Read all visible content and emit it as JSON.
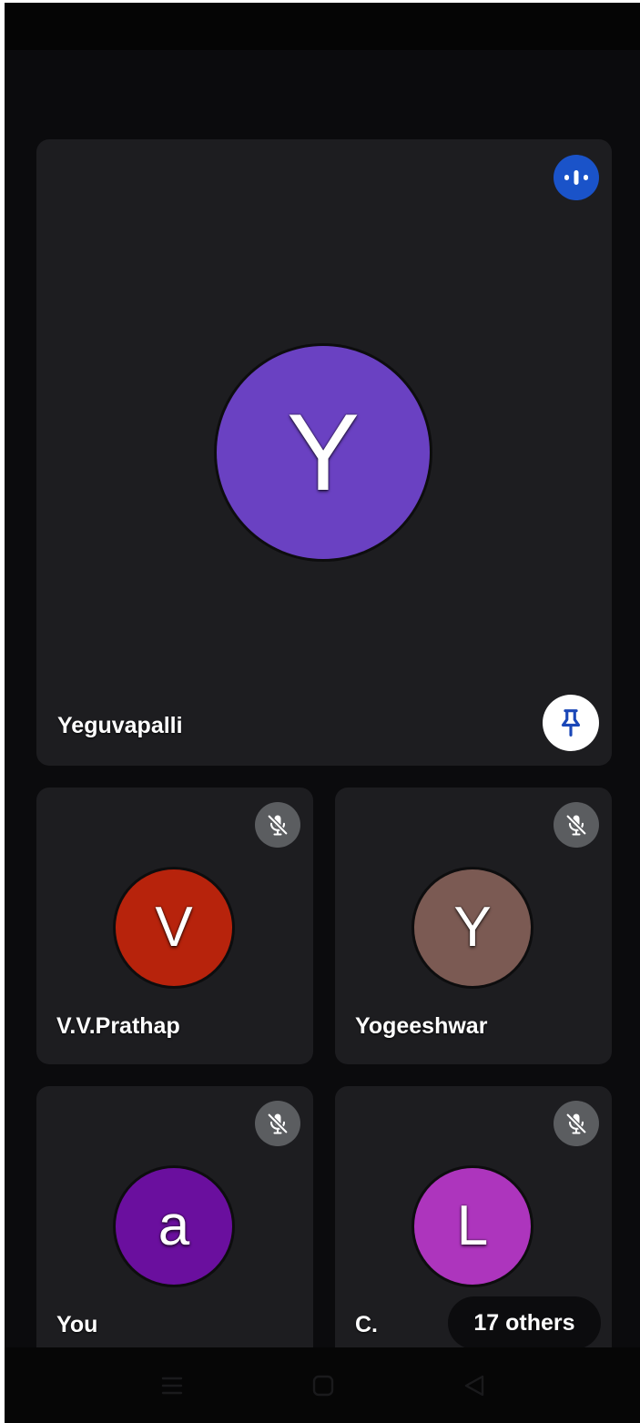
{
  "main_tile": {
    "name": "Yeguvapalli",
    "initial": "Y",
    "avatar_color": "#6a41c2",
    "speaking_indicator": "audio-level-icon",
    "pin_icon": "pin-icon"
  },
  "tiles": [
    {
      "name": "V.V.Prathap",
      "initial": "V",
      "avatar_color": "#b7230c",
      "status_icon": "mic-off-icon"
    },
    {
      "name": "Yogeeshwar",
      "initial": "Y",
      "avatar_color": "#7b5a53",
      "status_icon": "mic-off-icon"
    },
    {
      "name": "You",
      "initial": "a",
      "avatar_color": "#6a0f9e",
      "status_icon": "mic-off-icon"
    },
    {
      "name": "C.",
      "initial": "L",
      "avatar_color": "#ad35bd",
      "status_icon": "mic-off-icon",
      "others_label": "17 others"
    }
  ],
  "nav_bar": {
    "icons": [
      "menu-icon",
      "home-icon",
      "back-icon"
    ]
  },
  "colors": {
    "background": "#0b0b0d",
    "tile": "#1d1d20",
    "speaking_badge": "#1a53c9",
    "mute_badge": "#5b5d60"
  }
}
